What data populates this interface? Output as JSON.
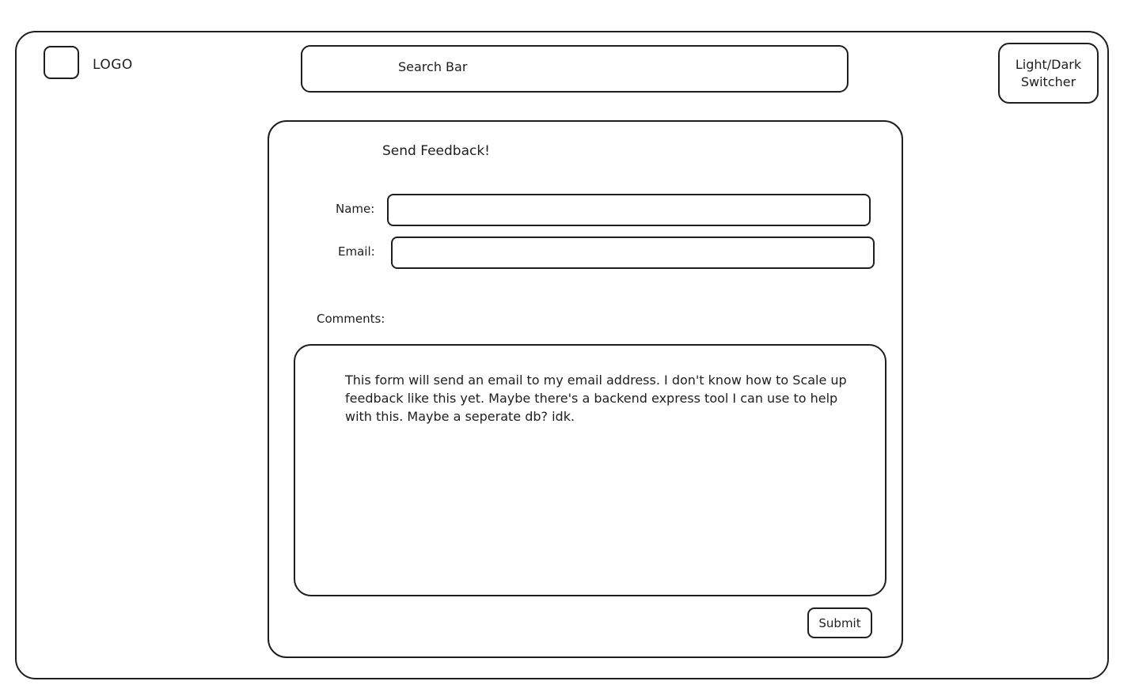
{
  "header": {
    "logo_text": "LOGO",
    "search_label": "Search Bar",
    "theme_switch_line1": "Light/Dark",
    "theme_switch_line2": "Switcher"
  },
  "form": {
    "title": "Send Feedback!",
    "name_label": "Name:",
    "name_value": "",
    "email_label": "Email:",
    "email_value": "",
    "comments_label": "Comments:",
    "comments_value": "This form will send an email to my email address. I don't know how to Scale up feedback like this yet. Maybe there's a backend express tool I can use to help with this. Maybe a seperate db? idk.",
    "submit_label": "Submit"
  }
}
